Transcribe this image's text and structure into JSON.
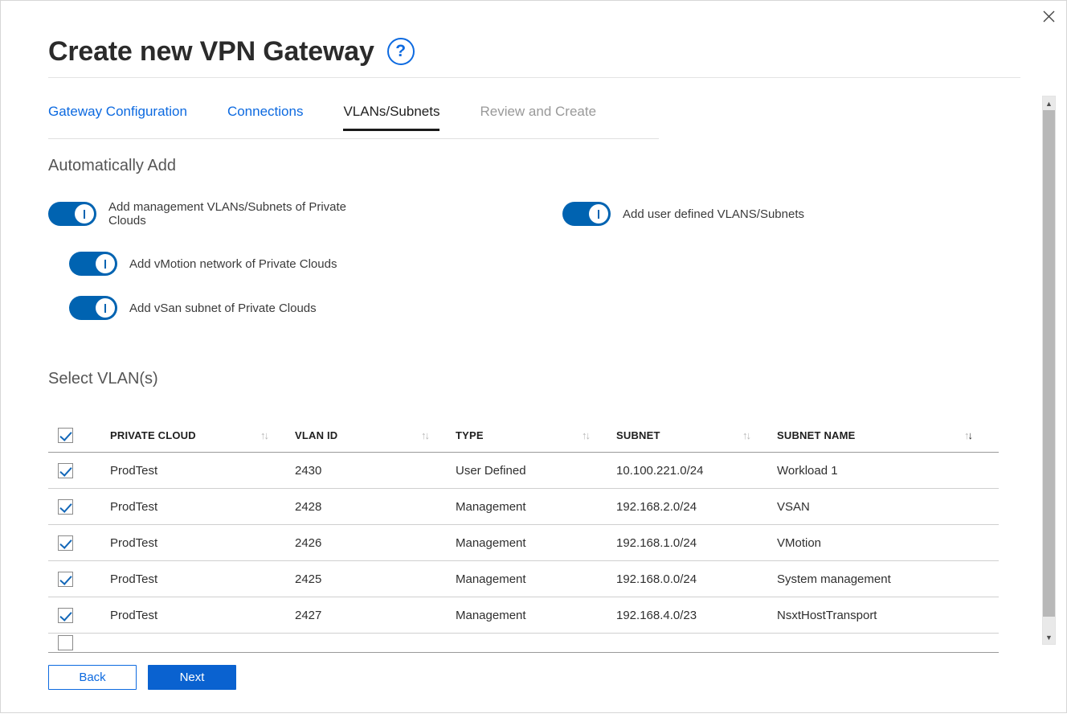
{
  "dialog": {
    "title": "Create new VPN Gateway",
    "help_icon_label": "?",
    "close_icon_label": "close-icon"
  },
  "tabs": [
    {
      "label": "Gateway Configuration",
      "state": "link"
    },
    {
      "label": "Connections",
      "state": "link"
    },
    {
      "label": "VLANs/Subnets",
      "state": "active"
    },
    {
      "label": "Review and Create",
      "state": "disabled"
    }
  ],
  "auto_add": {
    "heading": "Automatically Add",
    "toggles": [
      {
        "label": "Add management VLANs/Subnets of Private Clouds",
        "on": true
      },
      {
        "label": "Add user defined VLANS/Subnets",
        "on": true
      },
      {
        "label": "Add vMotion network of Private Clouds",
        "on": true
      },
      {
        "label": "Add vSan subnet of Private Clouds",
        "on": true
      }
    ]
  },
  "select_vlans": {
    "heading": "Select VLAN(s)",
    "select_all_checked": true,
    "columns": [
      {
        "label": "PRIVATE CLOUD",
        "sort": "none"
      },
      {
        "label": "VLAN ID",
        "sort": "none"
      },
      {
        "label": "TYPE",
        "sort": "none"
      },
      {
        "label": "SUBNET",
        "sort": "none"
      },
      {
        "label": "SUBNET NAME",
        "sort": "desc"
      }
    ],
    "rows": [
      {
        "checked": true,
        "private_cloud": "ProdTest",
        "vlan_id": "2430",
        "type": "User Defined",
        "subnet": "10.100.221.0/24",
        "subnet_name": "Workload 1"
      },
      {
        "checked": true,
        "private_cloud": "ProdTest",
        "vlan_id": "2428",
        "type": "Management",
        "subnet": "192.168.2.0/24",
        "subnet_name": "VSAN"
      },
      {
        "checked": true,
        "private_cloud": "ProdTest",
        "vlan_id": "2426",
        "type": "Management",
        "subnet": "192.168.1.0/24",
        "subnet_name": "VMotion"
      },
      {
        "checked": true,
        "private_cloud": "ProdTest",
        "vlan_id": "2425",
        "type": "Management",
        "subnet": "192.168.0.0/24",
        "subnet_name": "System management"
      },
      {
        "checked": true,
        "private_cloud": "ProdTest",
        "vlan_id": "2427",
        "type": "Management",
        "subnet": "192.168.4.0/23",
        "subnet_name": "NsxtHostTransport"
      }
    ]
  },
  "footer": {
    "back_label": "Back",
    "next_label": "Next"
  },
  "colors": {
    "accent_blue": "#0d6ae0",
    "toggle_on": "#0063b1",
    "primary_button": "#0a62d0",
    "disabled_text": "#999999"
  }
}
